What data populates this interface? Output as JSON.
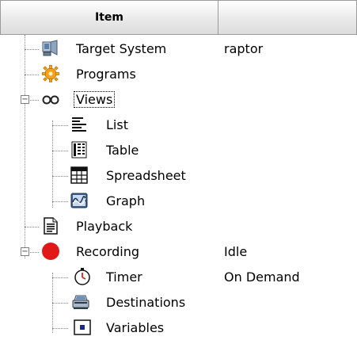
{
  "header": {
    "col1": "Item",
    "col2": ""
  },
  "rows": [
    {
      "label": "Target System",
      "value": "raptor",
      "icon": "computer-icon"
    },
    {
      "label": "Programs",
      "value": "",
      "icon": "gear-icon"
    },
    {
      "label": "Views",
      "value": "",
      "icon": "glasses-icon",
      "expanded": true,
      "focused": true
    },
    {
      "label": "List",
      "value": "",
      "icon": "list-icon"
    },
    {
      "label": "Table",
      "value": "",
      "icon": "table-icon"
    },
    {
      "label": "Spreadsheet",
      "value": "",
      "icon": "spreadsheet-icon"
    },
    {
      "label": "Graph",
      "value": "",
      "icon": "graph-icon"
    },
    {
      "label": "Playback",
      "value": "",
      "icon": "document-icon"
    },
    {
      "label": "Recording",
      "value": "Idle",
      "icon": "record-icon",
      "expanded": true
    },
    {
      "label": "Timer",
      "value": "On Demand",
      "icon": "timer-icon"
    },
    {
      "label": "Destinations",
      "value": "",
      "icon": "scanner-icon"
    },
    {
      "label": "Variables",
      "value": "",
      "icon": "variable-icon"
    }
  ]
}
